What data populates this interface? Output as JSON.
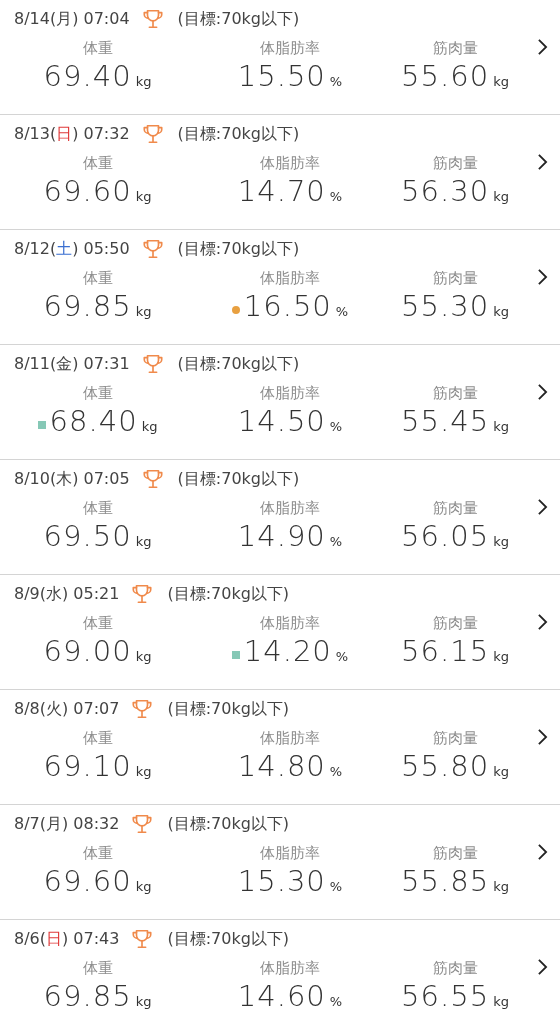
{
  "entries": [
    {
      "date": "8/14",
      "weekday": {
        "open": "(",
        "text": "月",
        "close": ")",
        "color": "#444444"
      },
      "time": "07:04",
      "goal": "(目標:70kg以下)",
      "metrics": [
        {
          "label": "体重",
          "value": "69.40",
          "unit": "kg"
        },
        {
          "label": "体脂肪率",
          "value": "15.50",
          "unit": "%"
        },
        {
          "label": "筋肉量",
          "value": "55.60",
          "unit": "kg"
        }
      ]
    },
    {
      "date": "8/13",
      "weekday": {
        "open": "(",
        "text": "日",
        "close": ")",
        "color": "#e03a3a"
      },
      "time": "07:32",
      "goal": "(目標:70kg以下)",
      "metrics": [
        {
          "label": "体重",
          "value": "69.60",
          "unit": "kg"
        },
        {
          "label": "体脂肪率",
          "value": "14.70",
          "unit": "%"
        },
        {
          "label": "筋肉量",
          "value": "56.30",
          "unit": "kg"
        }
      ]
    },
    {
      "date": "8/12",
      "weekday": {
        "open": "(",
        "text": "土",
        "close": ")",
        "color": "#3a6fd0"
      },
      "time": "05:50",
      "goal": "(目標:70kg以下)",
      "metrics": [
        {
          "label": "体重",
          "value": "69.85",
          "unit": "kg"
        },
        {
          "label": "体脂肪率",
          "value": "16.50",
          "unit": "%",
          "marker": {
            "kind": "dot",
            "color": "#e8a040"
          }
        },
        {
          "label": "筋肉量",
          "value": "55.30",
          "unit": "kg"
        }
      ]
    },
    {
      "date": "8/11",
      "weekday": {
        "open": "(",
        "text": "金",
        "close": ")",
        "color": "#444444"
      },
      "time": "07:31",
      "goal": "(目標:70kg以下)",
      "metrics": [
        {
          "label": "体重",
          "value": "68.40",
          "unit": "kg",
          "marker": {
            "kind": "square",
            "color": "#86c8b6"
          }
        },
        {
          "label": "体脂肪率",
          "value": "14.50",
          "unit": "%"
        },
        {
          "label": "筋肉量",
          "value": "55.45",
          "unit": "kg"
        }
      ]
    },
    {
      "date": "8/10",
      "weekday": {
        "open": "(",
        "text": "木",
        "close": ")",
        "color": "#444444"
      },
      "time": "07:05",
      "goal": "(目標:70kg以下)",
      "metrics": [
        {
          "label": "体重",
          "value": "69.50",
          "unit": "kg"
        },
        {
          "label": "体脂肪率",
          "value": "14.90",
          "unit": "%"
        },
        {
          "label": "筋肉量",
          "value": "56.05",
          "unit": "kg"
        }
      ]
    },
    {
      "date": "8/9",
      "weekday": {
        "open": "(",
        "text": "水",
        "close": ")",
        "color": "#444444"
      },
      "time": "05:21",
      "goal": "(目標:70kg以下)",
      "metrics": [
        {
          "label": "体重",
          "value": "69.00",
          "unit": "kg"
        },
        {
          "label": "体脂肪率",
          "value": "14.20",
          "unit": "%",
          "marker": {
            "kind": "square",
            "color": "#86c8b6"
          }
        },
        {
          "label": "筋肉量",
          "value": "56.15",
          "unit": "kg"
        }
      ]
    },
    {
      "date": "8/8",
      "weekday": {
        "open": "(",
        "text": "火",
        "close": ")",
        "color": "#444444"
      },
      "time": "07:07",
      "goal": "(目標:70kg以下)",
      "metrics": [
        {
          "label": "体重",
          "value": "69.10",
          "unit": "kg"
        },
        {
          "label": "体脂肪率",
          "value": "14.80",
          "unit": "%"
        },
        {
          "label": "筋肉量",
          "value": "55.80",
          "unit": "kg"
        }
      ]
    },
    {
      "date": "8/7",
      "weekday": {
        "open": "(",
        "text": "月",
        "close": ")",
        "color": "#444444"
      },
      "time": "08:32",
      "goal": "(目標:70kg以下)",
      "metrics": [
        {
          "label": "体重",
          "value": "69.60",
          "unit": "kg"
        },
        {
          "label": "体脂肪率",
          "value": "15.30",
          "unit": "%"
        },
        {
          "label": "筋肉量",
          "value": "55.85",
          "unit": "kg"
        }
      ]
    },
    {
      "date": "8/6",
      "weekday": {
        "open": "(",
        "text": "日",
        "close": ")",
        "color": "#e03a3a"
      },
      "time": "07:43",
      "goal": "(目標:70kg以下)",
      "metrics": [
        {
          "label": "体重",
          "value": "69.85",
          "unit": "kg"
        },
        {
          "label": "体脂肪率",
          "value": "14.60",
          "unit": "%"
        },
        {
          "label": "筋肉量",
          "value": "56.55",
          "unit": "kg"
        }
      ]
    }
  ]
}
